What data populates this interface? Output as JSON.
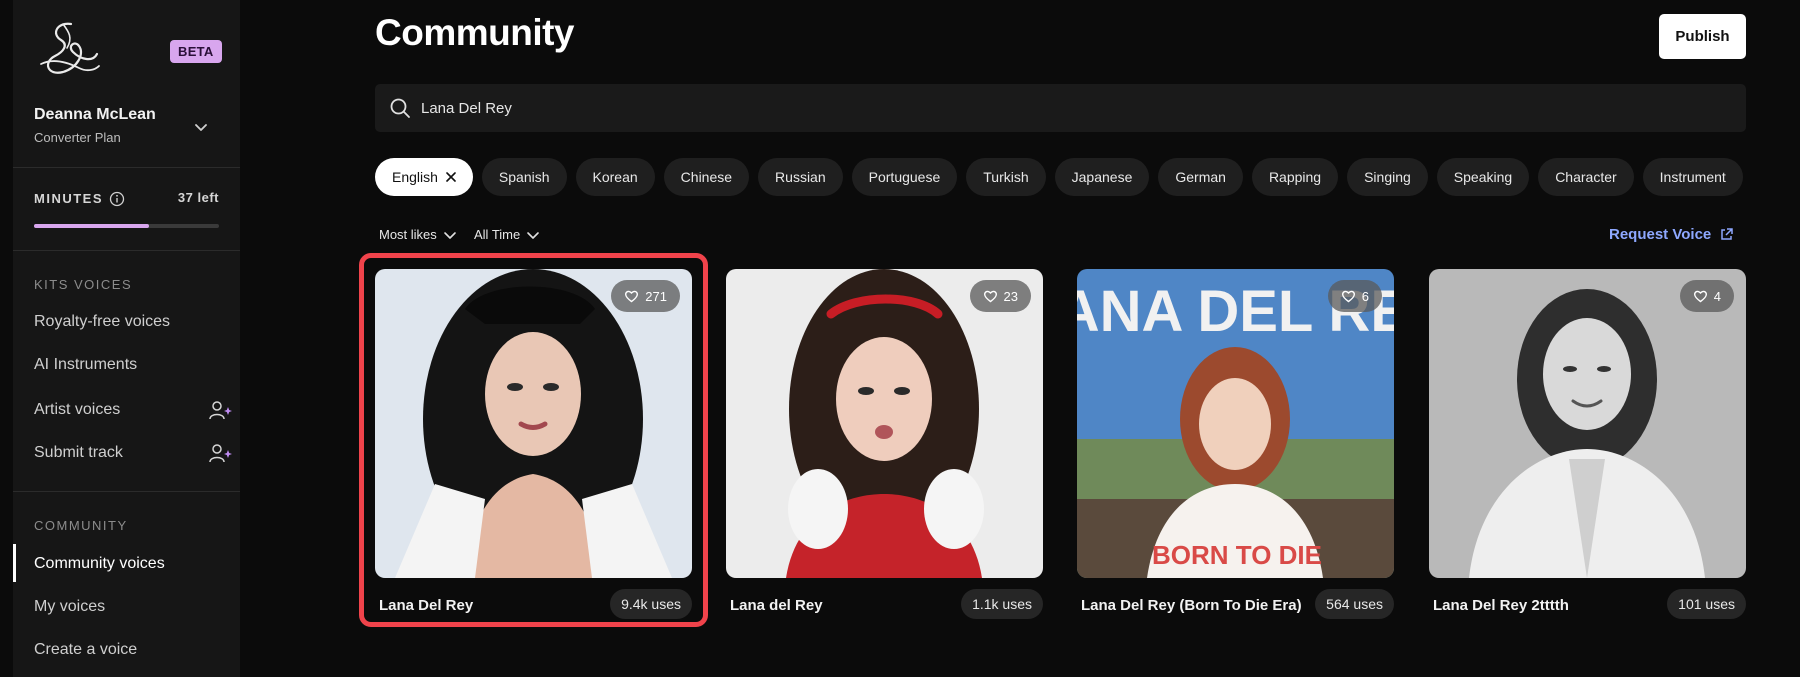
{
  "brand": {
    "beta_label": "BETA",
    "logo_icon": "kits-logo-icon"
  },
  "user": {
    "name": "Deanna McLean",
    "plan": "Converter Plan"
  },
  "minutes": {
    "label": "MINUTES",
    "left": "37 left",
    "progress_fraction": 0.62,
    "accent": "#d8a6ee"
  },
  "sidebar": {
    "kits_title": "KITS VOICES",
    "kits_items": [
      {
        "label": "Royalty-free voices"
      },
      {
        "label": "AI Instruments"
      },
      {
        "label": "Artist voices",
        "icon": "user-sparkle-icon"
      },
      {
        "label": "Submit track",
        "icon": "user-sparkle-icon"
      }
    ],
    "community_title": "COMMUNITY",
    "community_items": [
      {
        "label": "Community voices",
        "active": true
      },
      {
        "label": "My voices"
      },
      {
        "label": "Create a voice"
      }
    ]
  },
  "header": {
    "title": "Community",
    "publish_label": "Publish"
  },
  "search": {
    "value": "Lana Del Rey",
    "placeholder": ""
  },
  "filters": [
    "English",
    "Spanish",
    "Korean",
    "Chinese",
    "Russian",
    "Portuguese",
    "Turkish",
    "Japanese",
    "German",
    "Rapping",
    "Singing",
    "Speaking",
    "Character",
    "Instrument"
  ],
  "selected_filter": "English",
  "sort": {
    "order": "Most likes",
    "range": "All Time"
  },
  "request_voice": "Request Voice",
  "cards": [
    {
      "name": "Lana Del Rey",
      "likes": "271",
      "uses": "9.4k uses",
      "highlighted": true
    },
    {
      "name": "Lana del Rey",
      "likes": "23",
      "uses": "1.1k uses"
    },
    {
      "name": "Lana Del Rey (Born To Die Era)",
      "likes": "6",
      "uses": "564 uses",
      "cover_title": "LANA DEL REY",
      "cover_subtitle": "BORN TO DIE"
    },
    {
      "name": "Lana Del Rey 2tttth",
      "likes": "4",
      "uses": "101 uses"
    }
  ],
  "colors": {
    "highlight": "#f0434b",
    "link": "#8ea8ff",
    "background": "#0b0b0b",
    "sidebar": "#161616"
  }
}
